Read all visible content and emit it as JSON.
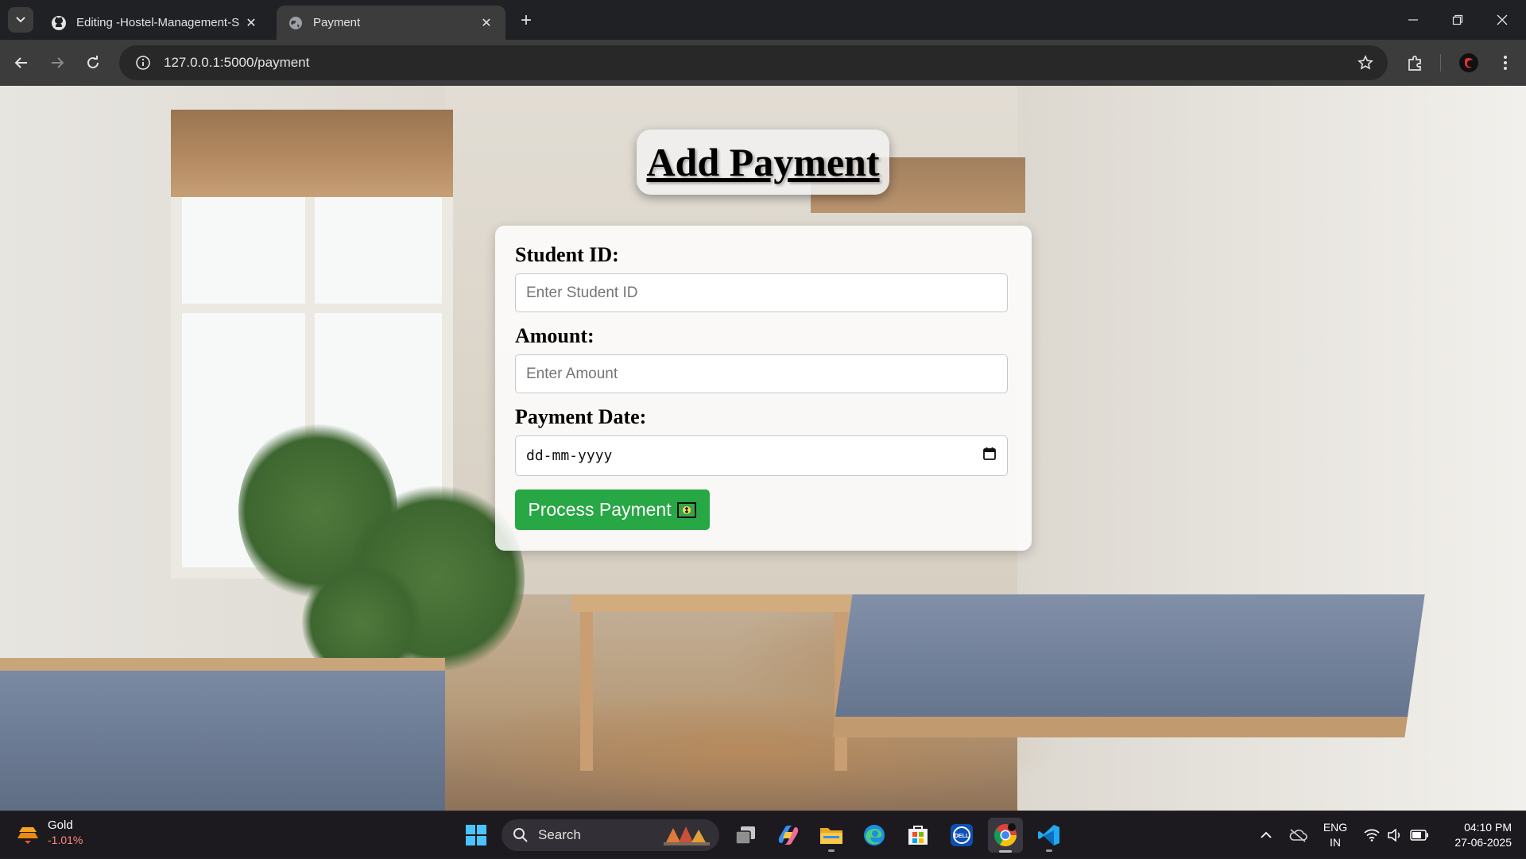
{
  "browser": {
    "tabs": [
      {
        "title": "Editing -Hostel-Management-S",
        "favicon": "github-icon",
        "active": false
      },
      {
        "title": "Payment",
        "favicon": "globe-icon",
        "active": true
      }
    ],
    "address": "127.0.0.1:5000/payment"
  },
  "page": {
    "heading": "Add Payment",
    "fields": {
      "student_id": {
        "label": "Student ID:",
        "placeholder": "Enter Student ID"
      },
      "amount": {
        "label": "Amount:",
        "placeholder": "Enter Amount"
      },
      "payment_date": {
        "label": "Payment Date:",
        "placeholder": "dd-mm-yyyy"
      }
    },
    "submit_label": "Process Payment",
    "colors": {
      "submit": "#28a745"
    }
  },
  "taskbar": {
    "widget": {
      "title": "Gold",
      "change": "-1.01%"
    },
    "search_label": "Search",
    "language": {
      "line1": "ENG",
      "line2": "IN"
    },
    "time": "04:10 PM",
    "date": "27-06-2025"
  }
}
